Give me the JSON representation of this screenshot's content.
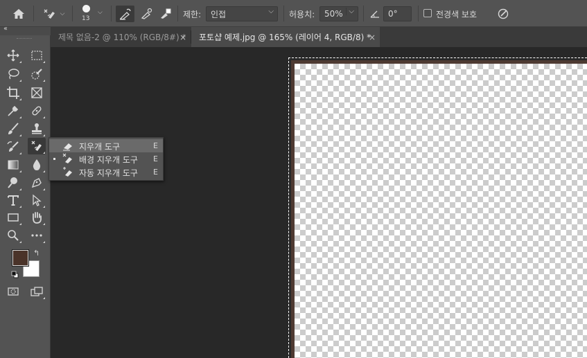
{
  "options_bar": {
    "brush_size": "13",
    "limit_label": "제한:",
    "limit_value": "인접",
    "tolerance_label": "허용치:",
    "tolerance_value": "50%",
    "angle_value": "0°",
    "protect_foreground_label": "전경색 보호",
    "protect_foreground_checked": false
  },
  "tabs": [
    {
      "title": "제목 없음-2 @ 110% (RGB/8#) *",
      "close": "×",
      "active": false
    },
    {
      "title": "포토샵 예제.jpg @ 165% (레이어 4, RGB/8) *",
      "close": "×",
      "active": true
    }
  ],
  "toolbar": {
    "collapse_label": "‹‹",
    "swap_label": "↰",
    "foreground_color": "#4a3329",
    "background_color": "#ffffff",
    "tools": [
      "move-icon",
      "marquee-icon",
      "lasso-icon",
      "quick-select-icon",
      "crop-icon",
      "frame-icon",
      "eyedropper-icon",
      "healing-brush-icon",
      "brush-icon",
      "clone-stamp-icon",
      "history-brush-icon",
      "eraser-icon",
      "gradient-icon",
      "blur-icon",
      "dodge-icon",
      "pen-icon",
      "type-icon",
      "path-select-icon",
      "rectangle-icon",
      "hand-icon",
      "zoom-icon",
      "more-tools-icon",
      "quick-mask-icon",
      "screen-mode-icon"
    ]
  },
  "flyout": {
    "items": [
      {
        "label": "지우개 도구",
        "shortcut": "E",
        "selected": false,
        "highlighted": true
      },
      {
        "label": "배경 지우개 도구",
        "shortcut": "E",
        "selected": true,
        "highlighted": false
      },
      {
        "label": "자동 지우개 도구",
        "shortcut": "E",
        "selected": false,
        "highlighted": false
      }
    ]
  },
  "colors": {
    "accent": "#4e3a32",
    "panel": "#535353",
    "workspace": "#282828"
  }
}
